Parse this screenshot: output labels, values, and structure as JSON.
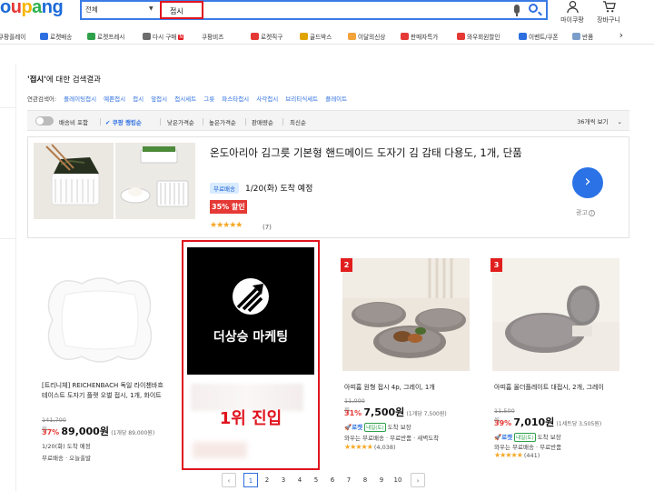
{
  "header": {
    "logo": [
      "o",
      "u",
      "p",
      "a",
      "n",
      "g"
    ],
    "category": "전체",
    "query": "접시",
    "my_coupang": "마이쿠팡",
    "cart": "장바구니"
  },
  "category_bar": [
    {
      "label": "쿠팡플레이",
      "color": "#f0f0f0"
    },
    {
      "label": "로켓배송",
      "color": "#2e6fe0"
    },
    {
      "label": "로켓프레시",
      "color": "#2ea04a"
    },
    {
      "label": "다시 구매",
      "color": "#6d6d6d",
      "badge": "N"
    },
    {
      "label": "쿠팡비즈",
      "color": "#2e6fe0"
    },
    {
      "label": "로켓직구",
      "color": "#e53935"
    },
    {
      "label": "골드박스",
      "color": "#e0a400"
    },
    {
      "label": "이달의신상",
      "color": "#f2a33a"
    },
    {
      "label": "판매자특가",
      "color": "#e53935"
    },
    {
      "label": "와우회원할인",
      "color": "#e53935"
    },
    {
      "label": "이벤트/쿠폰",
      "color": "#2e6fe0"
    },
    {
      "label": "반품",
      "color": "#7a9ec9"
    }
  ],
  "results": {
    "query_quoted": "'접시'",
    "title_suffix": "에 대한 검색결과",
    "related_label": "연관검색어:",
    "related": [
      "플레이팅접시",
      "예쁜접시",
      "접시",
      "앞접시",
      "접시세트",
      "그릇",
      "파스타접시",
      "사각접시",
      "브리티식세트",
      "플레이트"
    ]
  },
  "filters": {
    "delivery_toggle": "배송비 포함",
    "ranking": "쿠팡 랭킹순",
    "low_price": "낮은가격순",
    "high_price": "높은가격순",
    "sales": "판매량순",
    "latest": "최신순",
    "per_page": "36개씩 보기"
  },
  "ad": {
    "title": "온도아리아 김그릇 기본형 핸드메이드 도자기 김 감태 다용도, 1개, 단품",
    "free_shipping": "무료배송",
    "delivery": "1/20(화) 도착 예정",
    "discount": "35% 할인",
    "rating": 4.5,
    "stars": "★★★★★",
    "reviews": "(7)",
    "label": "광고"
  },
  "products": [
    {
      "name": "[트리니체] REICHENBACH 독일 라이첸바흐 테이스트 도자기 플랫 오벌 접시, 1개, 화이트",
      "original": "141,700원",
      "pct": "37%",
      "price": "89,000원",
      "unit": "(1개당 89,000원)",
      "delivery": "1/20(화) 도착 예정",
      "shipping": "무료배송 · 오늘출발"
    },
    {
      "overlay": "더상승 마케팅",
      "highlight": "1위 진입"
    },
    {
      "rank": "2",
      "name": "아띠홈 원형 접시 4p, 그레이, 1개",
      "original": "11,000원",
      "pct": "31%",
      "price": "7,500원",
      "unit": "(1개당 7,500원)",
      "rocket": "로켓",
      "badge": "내일(토)",
      "delivery": "도착 보장",
      "wow": "와우는 무료배송 · 무료반품 · 새벽도착",
      "rating": 4.5,
      "stars": "★★★★★",
      "reviews": "(4,038)"
    },
    {
      "rank": "3",
      "name": "아띠홈 올더플레이트 대접시, 2개, 그레이",
      "original": "11,500원",
      "pct": "39%",
      "price": "7,010원",
      "unit": "(1세트당 3,505원)",
      "rocket": "로켓",
      "badge": "내일(토)",
      "delivery": "도착 보장",
      "wow": "와우는 무료배송 · 무료반품",
      "rating": 4.5,
      "stars": "★★★★★",
      "reviews": "(441)"
    }
  ],
  "pagination": {
    "prev": "‹",
    "pages": [
      "1",
      "2",
      "3",
      "4",
      "5",
      "6",
      "7",
      "8",
      "9",
      "10"
    ],
    "current": "1",
    "next": "›"
  }
}
